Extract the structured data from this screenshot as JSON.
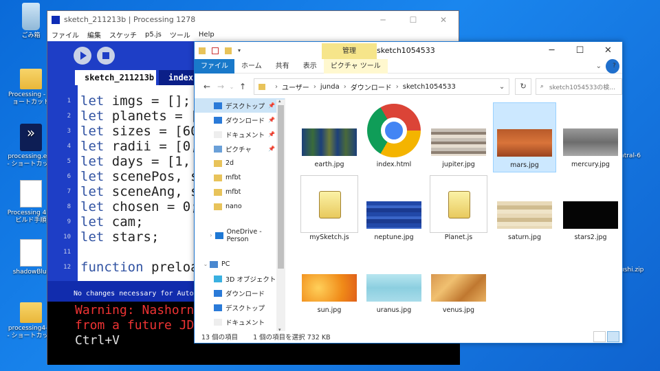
{
  "desktop": {
    "icons": [
      {
        "label": "ごみ箱"
      },
      {
        "label": "Processing - ショートカット"
      },
      {
        "label": "processing.exe - ショートカット"
      },
      {
        "label": "Processing 4 のビルド手順"
      },
      {
        "label": "shadowBlur"
      },
      {
        "label": "processing4-m - ショートカット"
      }
    ],
    "right_labels": [
      "ntral-6",
      "ushi.zip"
    ]
  },
  "processing": {
    "title": "sketch_211213b | Processing 1278",
    "menu": [
      "ファイル",
      "編集",
      "スケッチ",
      "p5.js",
      "ツール",
      "Help"
    ],
    "tabs": [
      "sketch_211213b",
      "index."
    ],
    "code": [
      {
        "n": "1",
        "kw": "let",
        "rest": " imgs = [];"
      },
      {
        "n": "2",
        "kw": "let",
        "rest": " planets = []"
      },
      {
        "n": "3",
        "kw": "let",
        "rest": " sizes = [60,"
      },
      {
        "n": "4",
        "kw": "let",
        "rest": " radii = [0,"
      },
      {
        "n": "5",
        "kw": "let",
        "rest": " days = [1, 8"
      },
      {
        "n": "6",
        "kw": "let",
        "rest": " scenePos, sc"
      },
      {
        "n": "7",
        "kw": "let",
        "rest": " sceneAng, sc"
      },
      {
        "n": "8",
        "kw": "let",
        "rest": " chosen = 0;"
      },
      {
        "n": "9",
        "kw": "let",
        "rest": " cam;"
      },
      {
        "n": "10",
        "kw": "let",
        "rest": " stars;"
      },
      {
        "n": "11",
        "kw": "",
        "rest": ""
      },
      {
        "n": "12",
        "kw": "function",
        "rest": " preload"
      }
    ],
    "status": "No changes necessary for Auto F",
    "console": [
      "Warning: Nashorn",
      "from a future JD",
      "Ctrl+V"
    ]
  },
  "explorer": {
    "title": "sketch1054533",
    "context_tab_header": "管理",
    "ribbon": [
      "ファイル",
      "ホーム",
      "共有",
      "表示",
      "ピクチャ ツール"
    ],
    "path": [
      "ユーザー",
      "junda",
      "ダウンロード",
      "sketch1054533"
    ],
    "search_placeholder": "sketch1054533の検...",
    "nav": [
      {
        "label": "デスクトップ",
        "pin": "📌",
        "sel": true
      },
      {
        "label": "ダウンロード",
        "pin": "📌"
      },
      {
        "label": "ドキュメント",
        "pin": "📌"
      },
      {
        "label": "ピクチャ",
        "pin": "📌"
      },
      {
        "label": "2d"
      },
      {
        "label": "mfbt"
      },
      {
        "label": "mfbt"
      },
      {
        "label": "nano"
      },
      {
        "label": ""
      },
      {
        "label": "OneDrive - Person"
      },
      {
        "label": ""
      },
      {
        "label": "PC"
      },
      {
        "label": "3D オブジェクト"
      },
      {
        "label": "ダウンロード"
      },
      {
        "label": "デスクトップ"
      },
      {
        "label": "ドキュメント"
      },
      {
        "label": "ピクチャ"
      }
    ],
    "files": [
      {
        "name": "earth.jpg",
        "kind": "img",
        "bg": "linear-gradient(90deg,#1c3f7a 0%,#3a6b3a 20%,#1c3f7a 35%,#6b7a3a 50%,#1c3f7a 65%,#4a6a3a 80%,#1c3f7a 100%)"
      },
      {
        "name": "index.html",
        "kind": "chrome"
      },
      {
        "name": "jupiter.jpg",
        "kind": "img",
        "bg": "repeating-linear-gradient(#c7bfb5 0 5px,#8d7f72 5px 9px,#e6ddd0 9px 14px)"
      },
      {
        "name": "mars.jpg",
        "kind": "img",
        "bg": "linear-gradient(#b85a2a,#d9743a,#9a4420)",
        "sel": true
      },
      {
        "name": "mercury.jpg",
        "kind": "img",
        "bg": "linear-gradient(#9a9a9a,#6d6d6d,#a8a8a8)"
      },
      {
        "name": "mySketch.js",
        "kind": "js"
      },
      {
        "name": "neptune.jpg",
        "kind": "img",
        "bg": "repeating-linear-gradient(#2148a8 0 6px,#3a66c8 6px 10px,#1a3a90 10px 16px)"
      },
      {
        "name": "Planet.js",
        "kind": "js"
      },
      {
        "name": "saturn.jpg",
        "kind": "img",
        "bg": "repeating-linear-gradient(#e8d9b8 0 6px,#d0bc90 6px 12px,#efe4c8 12px 18px)"
      },
      {
        "name": "stars2.jpg",
        "kind": "img",
        "bg": "#050505"
      },
      {
        "name": "sun.jpg",
        "kind": "img",
        "bg": "radial-gradient(circle at 30% 50%,#ffd05a,#f08a18 60%,#e0601a)"
      },
      {
        "name": "uranus.jpg",
        "kind": "img",
        "bg": "linear-gradient(#b8e6f0,#8ccfe0,#a8dcea)"
      },
      {
        "name": "venus.jpg",
        "kind": "img",
        "bg": "linear-gradient(135deg,#d89850,#f0c070,#c07830,#e8b060)"
      }
    ],
    "status": {
      "count": "13 個の項目",
      "selected": "1 個の項目を選択  732 KB"
    }
  }
}
